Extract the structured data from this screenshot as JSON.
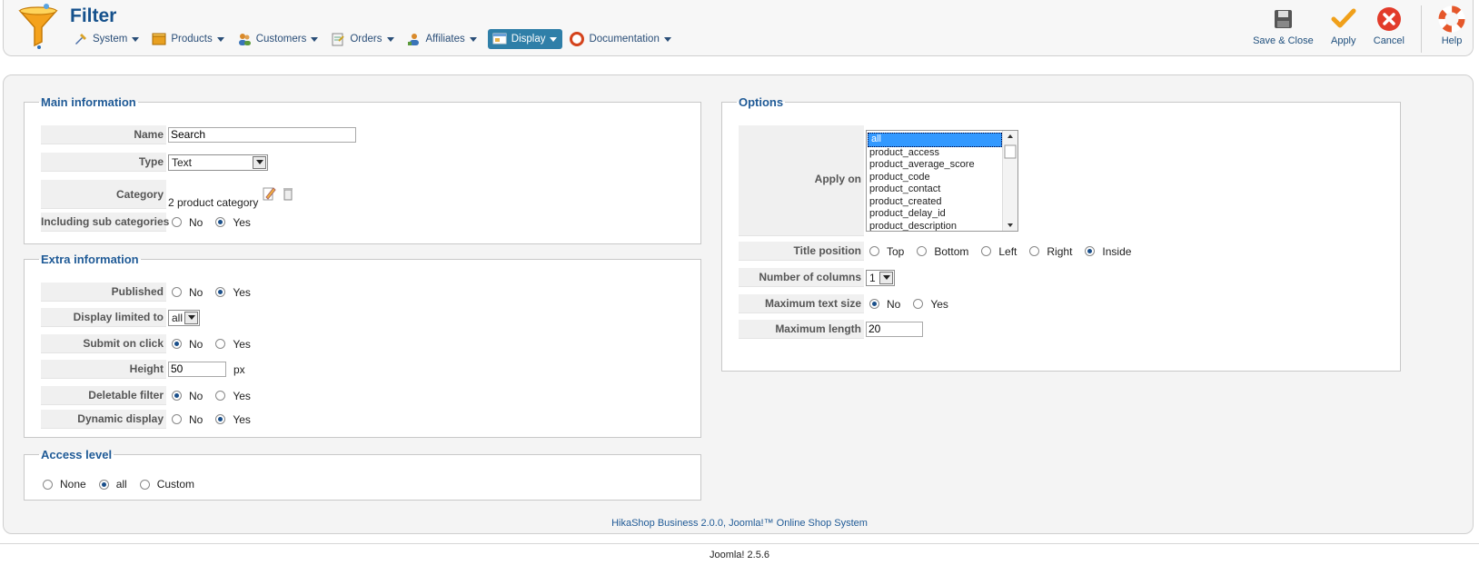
{
  "header": {
    "title": "Filter",
    "menu": [
      {
        "label": "System",
        "icon": "tools-icon"
      },
      {
        "label": "Products",
        "icon": "box-icon"
      },
      {
        "label": "Customers",
        "icon": "users-icon"
      },
      {
        "label": "Orders",
        "icon": "orders-icon"
      },
      {
        "label": "Affiliates",
        "icon": "affiliates-icon"
      },
      {
        "label": "Display",
        "icon": "display-icon",
        "active": true
      },
      {
        "label": "Documentation",
        "icon": "lifebuoy-icon"
      }
    ],
    "toolbar": {
      "save_close": "Save & Close",
      "apply": "Apply",
      "cancel": "Cancel",
      "help": "Help"
    }
  },
  "main_info": {
    "legend": "Main information",
    "name_label": "Name",
    "name_value": "Search",
    "type_label": "Type",
    "type_value": "Text",
    "category_label": "Category",
    "category_value": "2 product category",
    "subcat_label": "Including sub categories",
    "no": "No",
    "yes": "Yes"
  },
  "extra_info": {
    "legend": "Extra information",
    "published_label": "Published",
    "display_limited_label": "Display limited to",
    "display_limited_value": "all",
    "submit_label": "Submit on click",
    "height_label": "Height",
    "height_value": "50",
    "height_unit": "px",
    "deletable_label": "Deletable filter",
    "dynamic_label": "Dynamic display",
    "no": "No",
    "yes": "Yes"
  },
  "access": {
    "legend": "Access level",
    "none": "None",
    "all": "all",
    "custom": "Custom"
  },
  "options": {
    "legend": "Options",
    "apply_on_label": "Apply on",
    "apply_on_options": [
      "all",
      "product_access",
      "product_average_score",
      "product_code",
      "product_contact",
      "product_created",
      "product_delay_id",
      "product_description"
    ],
    "title_position_label": "Title position",
    "tp_top": "Top",
    "tp_bottom": "Bottom",
    "tp_left": "Left",
    "tp_right": "Right",
    "tp_inside": "Inside",
    "columns_label": "Number of columns",
    "columns_value": "1",
    "max_text_label": "Maximum text size",
    "max_length_label": "Maximum length",
    "max_length_value": "20",
    "no": "No",
    "yes": "Yes"
  },
  "footer": {
    "credit": "HikaShop Business 2.0.0, Joomla!™ Online Shop System",
    "version": "Joomla! 2.5.6"
  }
}
